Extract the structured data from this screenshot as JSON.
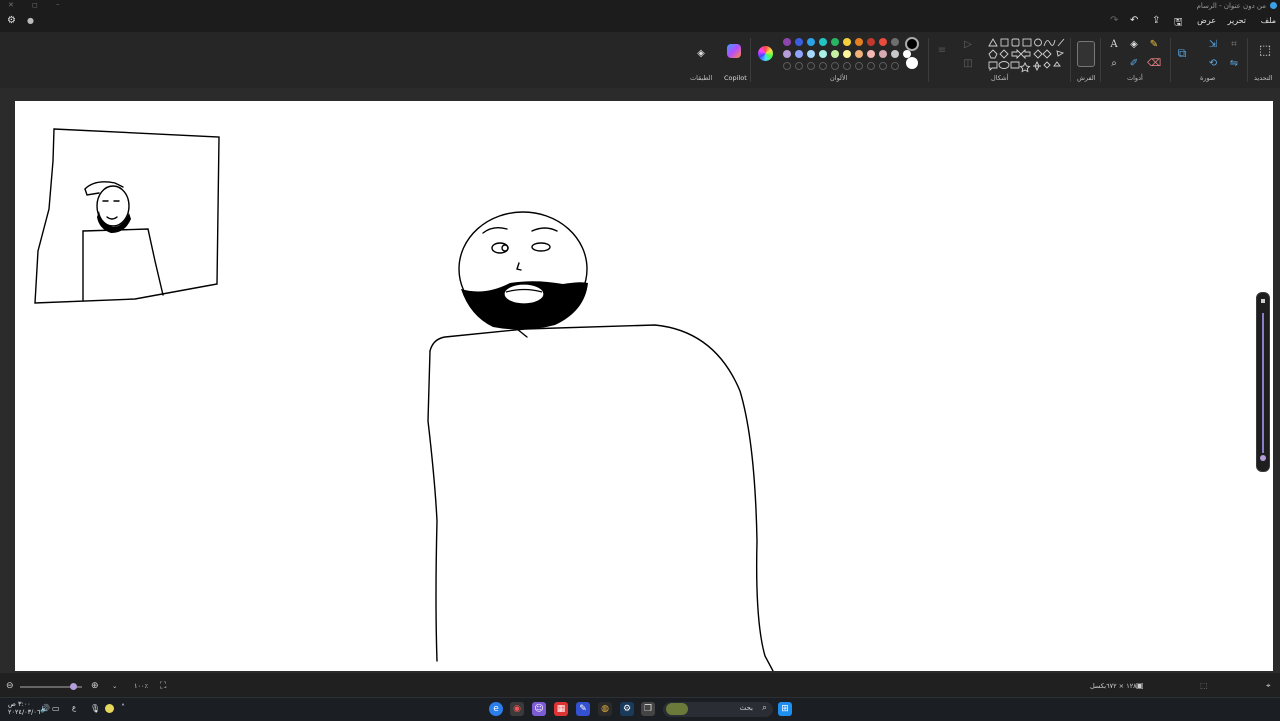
{
  "window": {
    "title": "من دون عنوان - الرسام"
  },
  "menu": {
    "file": "ملف",
    "edit": "تحرير",
    "view": "عرض"
  },
  "ribbon": {
    "selection_label": "التحديد",
    "image_label": "صورة",
    "tools_label": "أدوات",
    "brushes_label": "الفرش",
    "shapes_label": "أشكال",
    "colors_label": "الألوان",
    "copilot_label": "Copilot",
    "layers_label": "الطبقات",
    "text_tool_glyph": "A",
    "colors": {
      "row1": [
        "#8e44ad",
        "#3b5fe0",
        "#2aa3e8",
        "#23c4c4",
        "#28b463",
        "#f4d03f",
        "#e67e22",
        "#c0392b",
        "#e74c3c",
        "#6e6e6e"
      ],
      "row2": [
        "#b39ddb",
        "#90a4ff",
        "#a5d8ff",
        "#a8f0e8",
        "#c5f0a4",
        "#fff59d",
        "#f0b27a",
        "#f5b7b1",
        "#d7a9b0",
        "#c8c8c8",
        "#ffffff"
      ],
      "primary": "#000000",
      "secondary": "#ffffff"
    }
  },
  "status": {
    "canvas_size": "١٢٨٠ × ٦٧٢بكسل",
    "zoom": "١٠٠٪"
  },
  "taskbar": {
    "search_placeholder": "بحث",
    "time": "٣:٠٠ ص",
    "date": "٢٠٢٤/٠٣/٠٦",
    "lang": "ع"
  }
}
